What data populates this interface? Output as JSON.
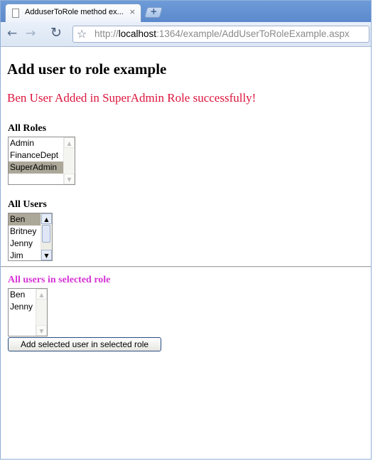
{
  "browser": {
    "tab_title": "AdduserToRole method ex...",
    "tab_close": "×",
    "new_tab": "+",
    "url_host": "localhost",
    "url_prefix": "http://",
    "url_rest": ":1364/example/AddUserToRoleExample.aspx"
  },
  "page": {
    "heading": "Add user to role example",
    "message": "Ben User Added in SuperAdmin Role successfully!",
    "message_color": "#dc143c"
  },
  "roles": {
    "label": "All Roles",
    "items": [
      "Admin",
      "FinanceDept",
      "SuperAdmin"
    ],
    "selected": "SuperAdmin"
  },
  "users": {
    "label": "All Users",
    "items": [
      "Ben",
      "Britney",
      "Jenny",
      "Jim"
    ],
    "selected": "Ben"
  },
  "users_in_role": {
    "label": "All users in selected role",
    "label_color": "#d633d6",
    "items": [
      "Ben",
      "Jenny"
    ]
  },
  "button": {
    "label": "Add selected user in selected role"
  },
  "icons": {
    "back": "back-arrow-icon",
    "forward": "forward-arrow-icon",
    "reload": "reload-icon",
    "bookmark": "star-icon",
    "page": "page-icon"
  }
}
